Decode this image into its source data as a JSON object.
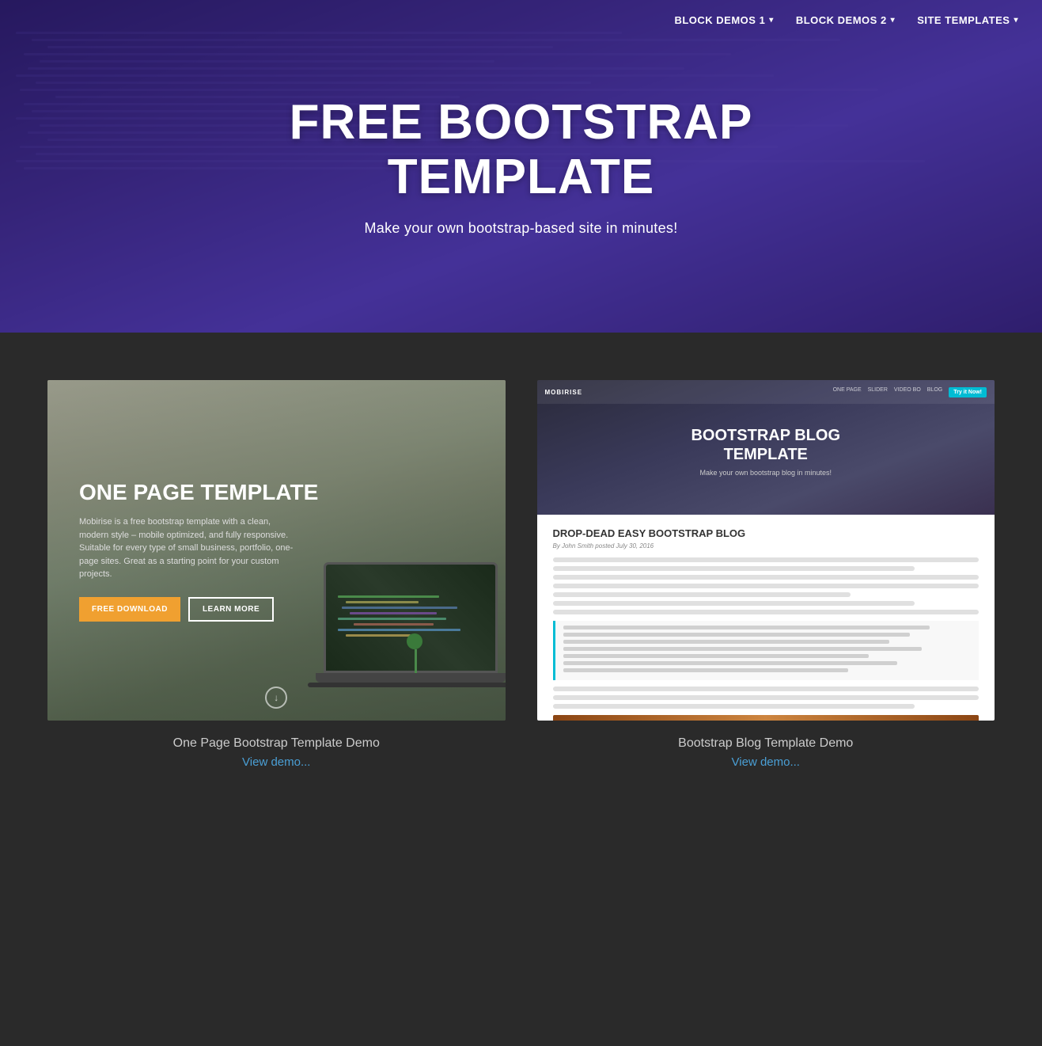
{
  "nav": {
    "items": [
      {
        "label": "BLOCK DEMOS 1",
        "hasDropdown": true
      },
      {
        "label": "BLOCK DEMOS 2",
        "hasDropdown": true
      },
      {
        "label": "SITE TEMPLATES",
        "hasDropdown": true
      }
    ]
  },
  "hero": {
    "title": "FREE BOOTSTRAP\nTEMPLATE",
    "subtitle": "Make your own bootstrap-based site in minutes!"
  },
  "cards": [
    {
      "id": "one-page",
      "template_title": "ONE PAGE TEMPLATE",
      "description": "Mobirise is a free bootstrap template with a clean, modern style – mobile optimized, and fully responsive. Suitable for every type of small business, portfolio, one-page sites. Great as a starting point for your custom projects.",
      "btn_primary": "FREE DOWNLOAD",
      "btn_secondary": "LEARN MORE",
      "label": "One Page Bootstrap Template Demo",
      "link": "View demo..."
    },
    {
      "id": "blog",
      "nav_brand": "MOBIRISE",
      "nav_links": [
        "ONE PAGE",
        "SLIDER",
        "VIDEO BO",
        "BLOG"
      ],
      "nav_cta": "Try it Now!",
      "template_title": "BOOTSTRAP BLOG\nTEMPLATE",
      "hero_sub": "Make your own bootstrap blog in minutes!",
      "article_title": "DROP-DEAD EASY BOOTSTRAP BLOG",
      "byline": "By John Smith posted July 30, 2016",
      "label": "Bootstrap Blog Template Demo",
      "link": "View demo..."
    }
  ]
}
